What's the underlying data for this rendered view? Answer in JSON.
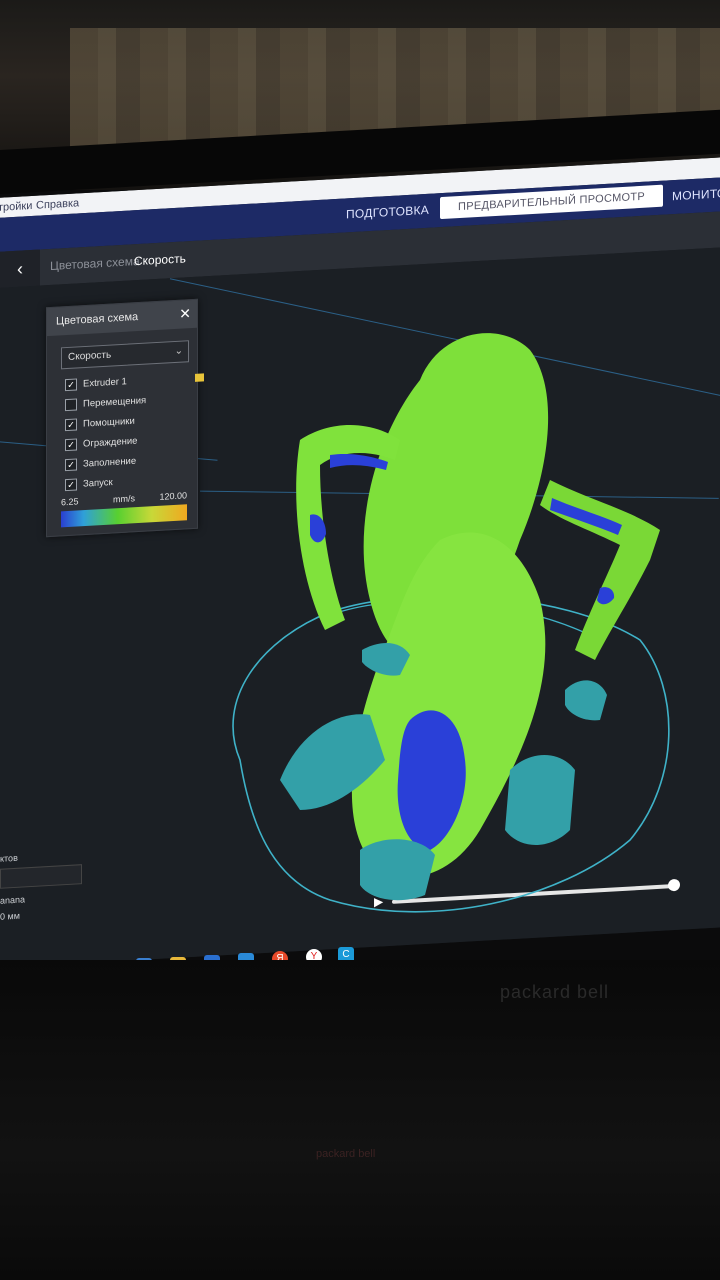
{
  "menu": {
    "items": [
      "тройки",
      "Справка"
    ]
  },
  "header": {
    "tabs": [
      {
        "label": "ПОДГОТОВКА",
        "active": false
      },
      {
        "label": "ПРЕДВАРИТЕЛЬНЫЙ ПРОСМОТР",
        "active": true
      },
      {
        "label": "МОНИТО",
        "active": false
      }
    ]
  },
  "subbar": {
    "crumb_inactive": "Цветовая схема",
    "crumb_active": "Скорость"
  },
  "color_scheme_panel": {
    "title": "Цветовая схема",
    "selected_scheme": "Скорость",
    "items": [
      {
        "label": "Extruder 1",
        "checked": true
      },
      {
        "label": "Перемещения",
        "checked": false
      },
      {
        "label": "Помощники",
        "checked": true
      },
      {
        "label": "Ограждение",
        "checked": true
      },
      {
        "label": "Заполнение",
        "checked": true
      },
      {
        "label": "Запуск",
        "checked": true
      }
    ],
    "scale_min": "6.25",
    "scale_unit": "mm/s",
    "scale_max": "120.00",
    "scale_colors": [
      "#2a3fd0",
      "#2fa0d8",
      "#58d030",
      "#c8d838",
      "#f0a820"
    ]
  },
  "sidebar_fragments": {
    "line1": "ктов",
    "line2": "anana",
    "line3": "0 мм"
  },
  "monitor_brand": "packard bell",
  "colors": {
    "header": "#1d2a66",
    "model_green": "#7ee03a",
    "support_teal": "#33a0a8",
    "slow_blue": "#2a40d8"
  }
}
